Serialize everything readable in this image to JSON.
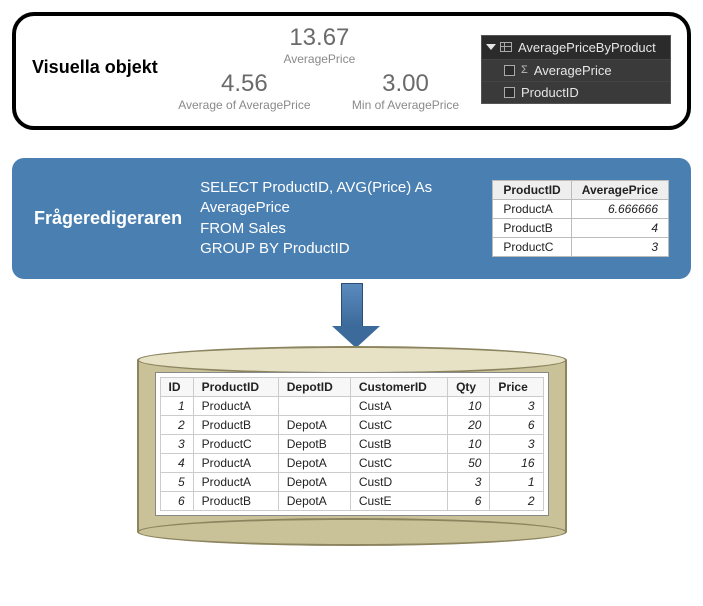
{
  "visual": {
    "title": "Visuella objekt",
    "stat_main": {
      "value": "13.67",
      "label": "AveragePrice"
    },
    "stat_avg": {
      "value": "4.56",
      "label": "Average of AveragePrice"
    },
    "stat_min": {
      "value": "3.00",
      "label": "Min of AveragePrice"
    },
    "fields": {
      "table": "AveragePriceByProduct",
      "measure": "AveragePrice",
      "column": "ProductID"
    }
  },
  "query": {
    "title": "Frågeredigeraren",
    "sql_line1": "SELECT ProductID, AVG(Price) As",
    "sql_line2": "AveragePrice",
    "sql_line3": "FROM Sales",
    "sql_line4": "GROUP BY ProductID",
    "result": {
      "col1": "ProductID",
      "col2": "AveragePrice",
      "rows": [
        {
          "pid": "ProductA",
          "avg": "6.666666"
        },
        {
          "pid": "ProductB",
          "avg": "4"
        },
        {
          "pid": "ProductC",
          "avg": "3"
        }
      ]
    }
  },
  "sales": {
    "headers": {
      "id": "ID",
      "pid": "ProductID",
      "depot": "DepotID",
      "cust": "CustomerID",
      "qty": "Qty",
      "price": "Price"
    },
    "rows": [
      {
        "id": "1",
        "pid": "ProductA",
        "depot": "",
        "cust": "CustA",
        "qty": "10",
        "price": "3"
      },
      {
        "id": "2",
        "pid": "ProductB",
        "depot": "DepotA",
        "cust": "CustC",
        "qty": "20",
        "price": "6"
      },
      {
        "id": "3",
        "pid": "ProductC",
        "depot": "DepotB",
        "cust": "CustB",
        "qty": "10",
        "price": "3"
      },
      {
        "id": "4",
        "pid": "ProductA",
        "depot": "DepotA",
        "cust": "CustC",
        "qty": "50",
        "price": "16"
      },
      {
        "id": "5",
        "pid": "ProductA",
        "depot": "DepotA",
        "cust": "CustD",
        "qty": "3",
        "price": "1"
      },
      {
        "id": "6",
        "pid": "ProductB",
        "depot": "DepotA",
        "cust": "CustE",
        "qty": "6",
        "price": "2"
      }
    ]
  }
}
